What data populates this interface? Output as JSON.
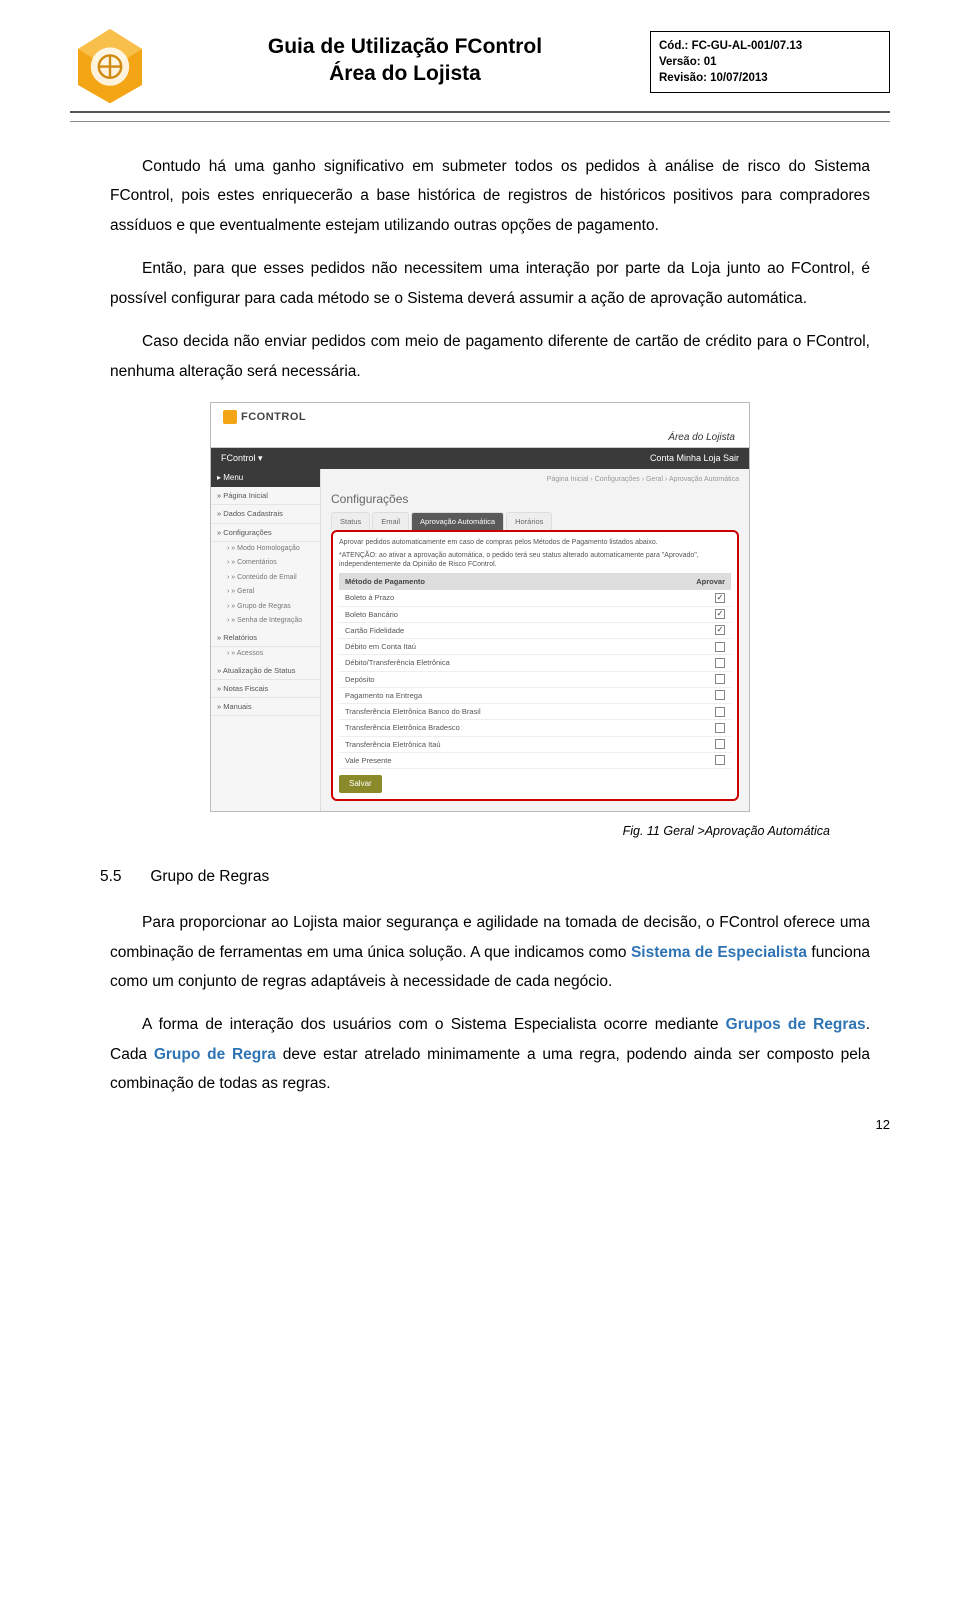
{
  "header": {
    "title_line1": "Guia de Utilização FControl",
    "title_line2": "Área do Lojista",
    "meta_cod": "Cód.: FC-GU-AL-001/07.13",
    "meta_versao": "Versão: 01",
    "meta_revisao": "Revisão: 10/07/2013"
  },
  "paragraphs": {
    "p1": "Contudo há uma ganho significativo em submeter todos os pedidos à análise de risco do Sistema FControl, pois estes enriquecerão a base histórica de registros de históricos positivos para compradores assíduos e que eventualmente estejam utilizando outras opções de pagamento.",
    "p2": "Então, para que esses pedidos não necessitem uma interação por parte da Loja junto ao FControl, é possível configurar para cada método se o Sistema deverá assumir a ação de aprovação automática.",
    "p3": "Caso decida não enviar pedidos com meio de pagamento diferente de cartão de crédito para o FControl, nenhuma alteração será necessária.",
    "p4a": "Para proporcionar ao Lojista maior segurança e agilidade na tomada de decisão, o FControl oferece uma combinação de ferramentas em uma única solução. A que indicamos como ",
    "p4_hl": "Sistema de Especialista",
    "p4b": " funciona como um conjunto de regras adaptáveis à necessidade de cada negócio.",
    "p5a": "A forma de interação dos usuários com o Sistema Especialista ocorre mediante ",
    "p5_hl1": "Grupos de Regras",
    "p5mid": ". Cada ",
    "p5_hl2": "Grupo de Regra",
    "p5b": " deve estar atrelado minimamente a uma regra, podendo ainda ser composto pela combinação de todas as regras."
  },
  "caption": "Fig. 11 Geral >Aprovação Automática",
  "section": {
    "num": "5.5",
    "title": "Grupo de Regras"
  },
  "screenshot": {
    "brand": "FCONTROL",
    "area": "Área do Lojista",
    "bar_left": "FControl ▾",
    "bar_right": "Conta  Minha Loja  Sair",
    "side_menu_label": "▸ Menu",
    "side_items": [
      "» Página Inicial",
      "» Dados Cadastrais",
      "» Configurações"
    ],
    "side_sub": [
      "› » Modo Homologação",
      "› » Comentários",
      "› » Conteúdo de Email",
      "› » Geral",
      "› » Grupo de Regras",
      "› » Senha de Integração"
    ],
    "side_items2": [
      "» Relatórios"
    ],
    "side_sub2": [
      "› » Acessos"
    ],
    "side_items3": [
      "» Atualização de Status",
      "» Notas Fiscais",
      "» Manuais"
    ],
    "main_title": "Configurações",
    "crumb": "Página Inicial › Configurações › Geral › Aprovação Automática",
    "tabs": [
      "Status",
      "Email",
      "Aprovação Automática",
      "Horários"
    ],
    "note1": "Aprovar pedidos automaticamente em caso de compras pelos Métodos de Pagamento listados abaixo.",
    "note2": "*ATENÇÃO: ao ativar a aprovação automática, o pedido terá seu status alterado automaticamente para \"Aprovado\", independentemente da Opinião de Risco FControl.",
    "th_method": "Método de Pagamento",
    "th_approve": "Aprovar",
    "rows": [
      {
        "m": "Boleto à Prazo",
        "c": true
      },
      {
        "m": "Boleto Bancário",
        "c": true
      },
      {
        "m": "Cartão Fidelidade",
        "c": true
      },
      {
        "m": "Débito em Conta Itaú",
        "c": false
      },
      {
        "m": "Débito/Transferência Eletrônica",
        "c": false
      },
      {
        "m": "Depósito",
        "c": false
      },
      {
        "m": "Pagamento na Entrega",
        "c": false
      },
      {
        "m": "Transferência Eletrônica Banco do Brasil",
        "c": false
      },
      {
        "m": "Transferência Eletrônica Bradesco",
        "c": false
      },
      {
        "m": "Transferência Eletrônica Itaú",
        "c": false
      },
      {
        "m": "Vale Presente",
        "c": false
      }
    ],
    "save_btn": "Salvar"
  },
  "page_number": "12"
}
